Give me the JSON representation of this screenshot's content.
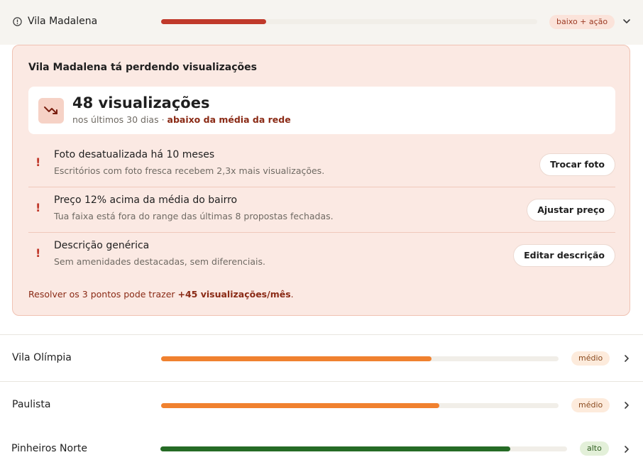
{
  "rows": [
    {
      "name": "Vila Madalena",
      "level": 0.28,
      "badge": "baixo + ação",
      "bar_color": "#c0392b",
      "badge_bg": "#fbe3da",
      "badge_fg": "#9c3a23",
      "expanded": true
    },
    {
      "name": "Vila Olímpia",
      "level": 0.68,
      "badge": "médio",
      "bar_color": "#f0812f",
      "badge_bg": "#fdebdc",
      "badge_fg": "#8a4a1e",
      "expanded": false
    },
    {
      "name": "Paulista",
      "level": 0.7,
      "badge": "médio",
      "bar_color": "#f0812f",
      "badge_bg": "#fdebdc",
      "badge_fg": "#8a4a1e",
      "expanded": false
    },
    {
      "name": "Pinheiros Norte",
      "level": 0.86,
      "badge": "alto",
      "bar_color": "#256b25",
      "badge_bg": "#e3f0d9",
      "badge_fg": "#2f5e1f",
      "expanded": false
    }
  ],
  "panel": {
    "title": "Vila Madalena tá perdendo visualizações",
    "stats": {
      "number": "48 visualizações",
      "period": "nos últimos 30 dias · ",
      "highlight": "abaixo da média da rede"
    },
    "issues": [
      {
        "title": "Foto desatualizada há 10 meses",
        "desc": "Escritórios com foto fresca recebem 2,3x mais visualizações.",
        "action": "Trocar foto"
      },
      {
        "title": "Preço 12% acima da média do bairro",
        "desc": "Tua faixa está fora do range das últimas 8 propostas fechadas.",
        "action": "Ajustar preço"
      },
      {
        "title": "Descrição genérica",
        "desc": "Sem amenidades destacadas, sem diferenciais.",
        "action": "Editar descrição"
      }
    ],
    "footer_prefix": "Resolver os 3 pontos pode trazer ",
    "footer_highlight": "+45 visualizações/mês",
    "footer_suffix": ".",
    "alert_icon": "exclamation"
  },
  "icons": {
    "row0_icon": "info-circle-icon",
    "expand": "chevron-down-icon",
    "collapsed": "chevron-right-icon",
    "trend": "trend-down-icon"
  }
}
